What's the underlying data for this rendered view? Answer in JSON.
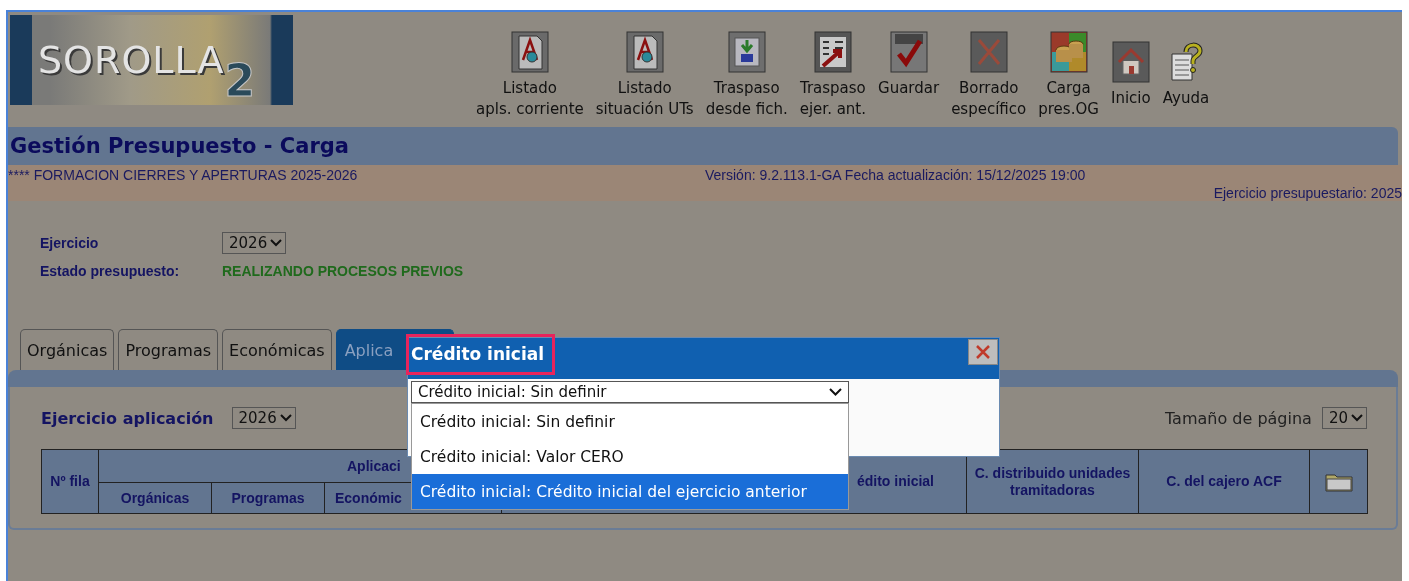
{
  "logo": {
    "name": "SOROLLA",
    "mark": "2"
  },
  "toolbar": [
    {
      "kind": "pdf",
      "lines": [
        "Listado",
        "apls. corriente"
      ]
    },
    {
      "kind": "pdf",
      "lines": [
        "Listado",
        "situación UTs"
      ]
    },
    {
      "kind": "import",
      "lines": [
        "Traspaso",
        "desde fich."
      ]
    },
    {
      "kind": "transfer",
      "lines": [
        "Traspaso",
        "ejer. ant."
      ]
    },
    {
      "kind": "save",
      "lines": [
        "Guardar"
      ]
    },
    {
      "kind": "delete",
      "lines": [
        "Borrado",
        "específico"
      ]
    },
    {
      "kind": "coins",
      "lines": [
        "Carga",
        "pres.OG"
      ]
    },
    {
      "kind": "home",
      "lines": [
        "Inicio"
      ]
    },
    {
      "kind": "help",
      "lines": [
        "Ayuda"
      ]
    }
  ],
  "page_title": "Gestión Presupuesto - Carga",
  "info": {
    "course": "**** FORMACION CIERRES Y APERTURAS 2025-2026",
    "version": "Versión: 9.2.113.1-GA Fecha actualización: 15/12/2025 19:00",
    "exercise": "Ejercicio presupuestario: 2025"
  },
  "form": {
    "ejercicio_label": "Ejercicio",
    "ejercicio_value": "2026",
    "estado_label": "Estado presupuesto:",
    "estado_value": "REALIZANDO PROCESOS PREVIOS"
  },
  "tabs": [
    {
      "label": "Orgánicas",
      "selected": false
    },
    {
      "label": "Programas",
      "selected": false
    },
    {
      "label": "Económicas",
      "selected": false
    },
    {
      "label": "Aplica",
      "selected": true
    }
  ],
  "panel": {
    "ejercicio_label": "Ejercicio aplicación",
    "ejercicio_value": "2026",
    "page_size_label": "Tamaño de página",
    "page_size_value": "20"
  },
  "table": {
    "row_number": "Nº fila",
    "group": "Aplicaci",
    "subcolumns": [
      "Orgánicas",
      "Programas",
      "Económic"
    ],
    "columns": [
      "édito inicial",
      "C. distribuido unidades tramitadoras",
      "C. del cajero ACF"
    ]
  },
  "dialog": {
    "title": "Crédito inicial",
    "select_value": "Crédito inicial: Sin definir",
    "options": [
      {
        "label": "Crédito inicial: Sin definir",
        "selected": false
      },
      {
        "label": "Crédito inicial: Valor CERO",
        "selected": false
      },
      {
        "label": "Crédito inicial: Crédito inicial del ejercicio anterior",
        "selected": true
      }
    ]
  }
}
